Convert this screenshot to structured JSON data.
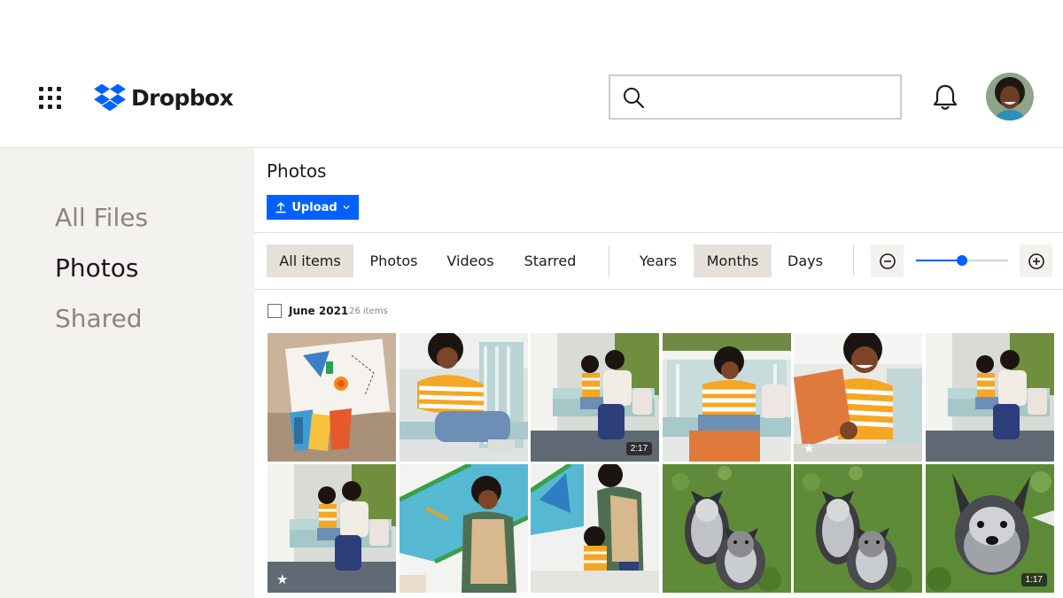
{
  "header": {
    "app_name": "Dropbox",
    "search": {
      "value": "",
      "placeholder": ""
    },
    "icons": [
      "app-grid-icon",
      "dropbox-logo-icon",
      "search-icon",
      "bell-icon",
      "avatar"
    ]
  },
  "sidebar": {
    "items": [
      {
        "label": "All Files",
        "active": false
      },
      {
        "label": "Photos",
        "active": true
      },
      {
        "label": "Shared",
        "active": false
      }
    ]
  },
  "main": {
    "title": "Photos",
    "upload_label": "Upload",
    "filters": [
      {
        "label": "All items",
        "selected": true
      },
      {
        "label": "Photos",
        "selected": false
      },
      {
        "label": "Videos",
        "selected": false
      },
      {
        "label": "Starred",
        "selected": false
      }
    ],
    "periods": [
      {
        "label": "Years",
        "selected": false
      },
      {
        "label": "Months",
        "selected": true
      },
      {
        "label": "Days",
        "selected": false
      }
    ],
    "zoom_level": 0.5,
    "group": {
      "date": "June 2021",
      "count": "26 items"
    },
    "tiles": [
      {
        "subject": "artwork-collage",
        "duration": "",
        "starred": false
      },
      {
        "subject": "boy-on-swing",
        "duration": "",
        "starred": false
      },
      {
        "subject": "boy-and-woman-on-swing",
        "duration": "2:17",
        "starred": false
      },
      {
        "subject": "boy-on-swing-with-pillow",
        "duration": "",
        "starred": false
      },
      {
        "subject": "boy-smiling-with-cloth",
        "duration": "",
        "starred": true
      },
      {
        "subject": "boy-and-woman-on-swing",
        "duration": "",
        "starred": false
      },
      {
        "subject": "boy-and-woman-on-swing",
        "duration": "",
        "starred": true
      },
      {
        "subject": "woman-painting-wall",
        "duration": "",
        "starred": false
      },
      {
        "subject": "woman-and-boy-painting",
        "duration": "",
        "starred": false
      },
      {
        "subject": "two-dogs-on-grass",
        "duration": "",
        "starred": false
      },
      {
        "subject": "two-dogs-on-grass",
        "duration": "",
        "starred": false
      },
      {
        "subject": "dog-close-up",
        "duration": "1:17",
        "starred": false
      }
    ],
    "colors": {
      "accent": "#0061fe",
      "selected_chip": "#e5e1da",
      "sidebar_bg": "#f4f2ef"
    }
  }
}
